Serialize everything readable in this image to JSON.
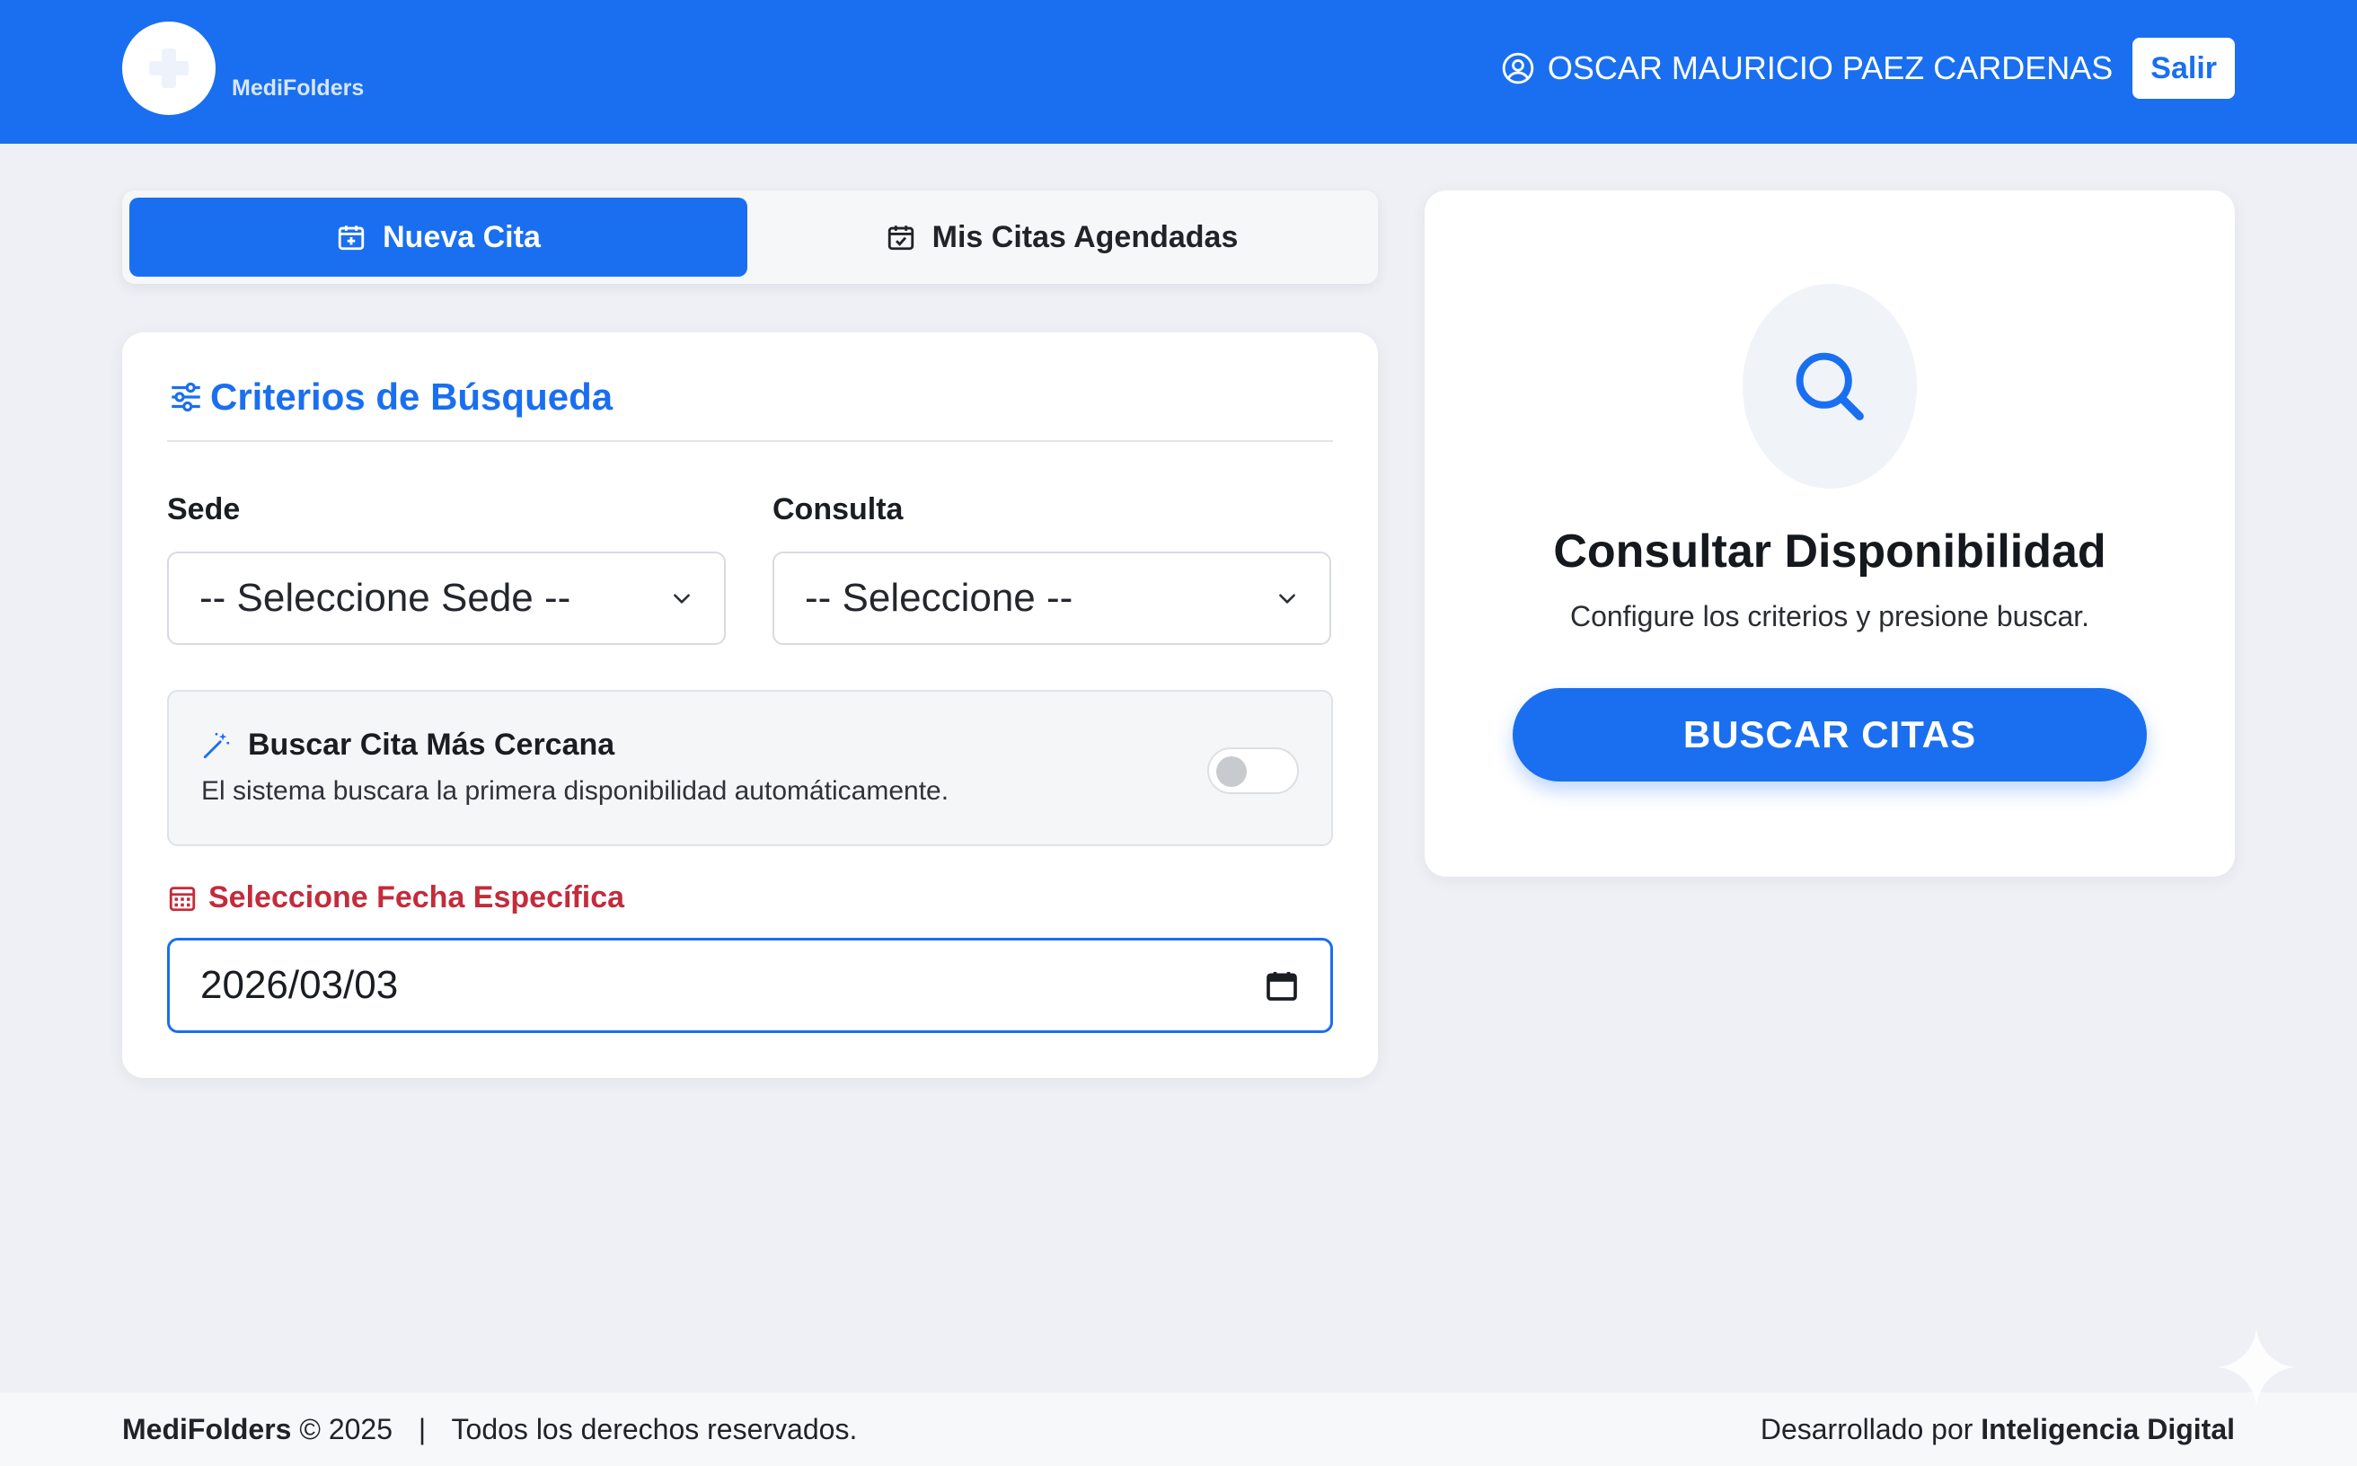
{
  "header": {
    "logo_text": "MediFolders",
    "user_name": "OSCAR MAURICIO PAEZ CARDENAS",
    "logout_label": "Salir",
    "bg_color": "#1a6ff0"
  },
  "tabs": [
    {
      "label": "Nueva Cita",
      "icon": "calendar-plus-icon",
      "active": true
    },
    {
      "label": "Mis Citas Agendadas",
      "icon": "calendar-check-icon",
      "active": false
    }
  ],
  "criteria": {
    "title": "Criterios de Búsqueda",
    "sede": {
      "label": "Sede",
      "selected": "-- Seleccione Sede --"
    },
    "consulta": {
      "label": "Consulta",
      "selected": "-- Seleccione --"
    },
    "nearest": {
      "title": "Buscar Cita Más Cercana",
      "description": "El sistema buscara la primera disponibilidad automáticamente.",
      "enabled": false
    },
    "date": {
      "label": "Seleccione Fecha Específica",
      "value": "2026/03/03"
    }
  },
  "availability": {
    "title": "Consultar Disponibilidad",
    "description": "Configure los criterios y presione buscar.",
    "button_label": "BUSCAR CITAS"
  },
  "footer": {
    "brand": "MediFolders",
    "copyright": "© 2025",
    "separator": "|",
    "rights": "Todos los derechos reservados.",
    "developed_prefix": "Desarrollado por",
    "developer": "Inteligencia Digital"
  },
  "colors": {
    "accent": "#1a6ff0",
    "danger": "#c42b3b",
    "background": "#eef0f5"
  }
}
